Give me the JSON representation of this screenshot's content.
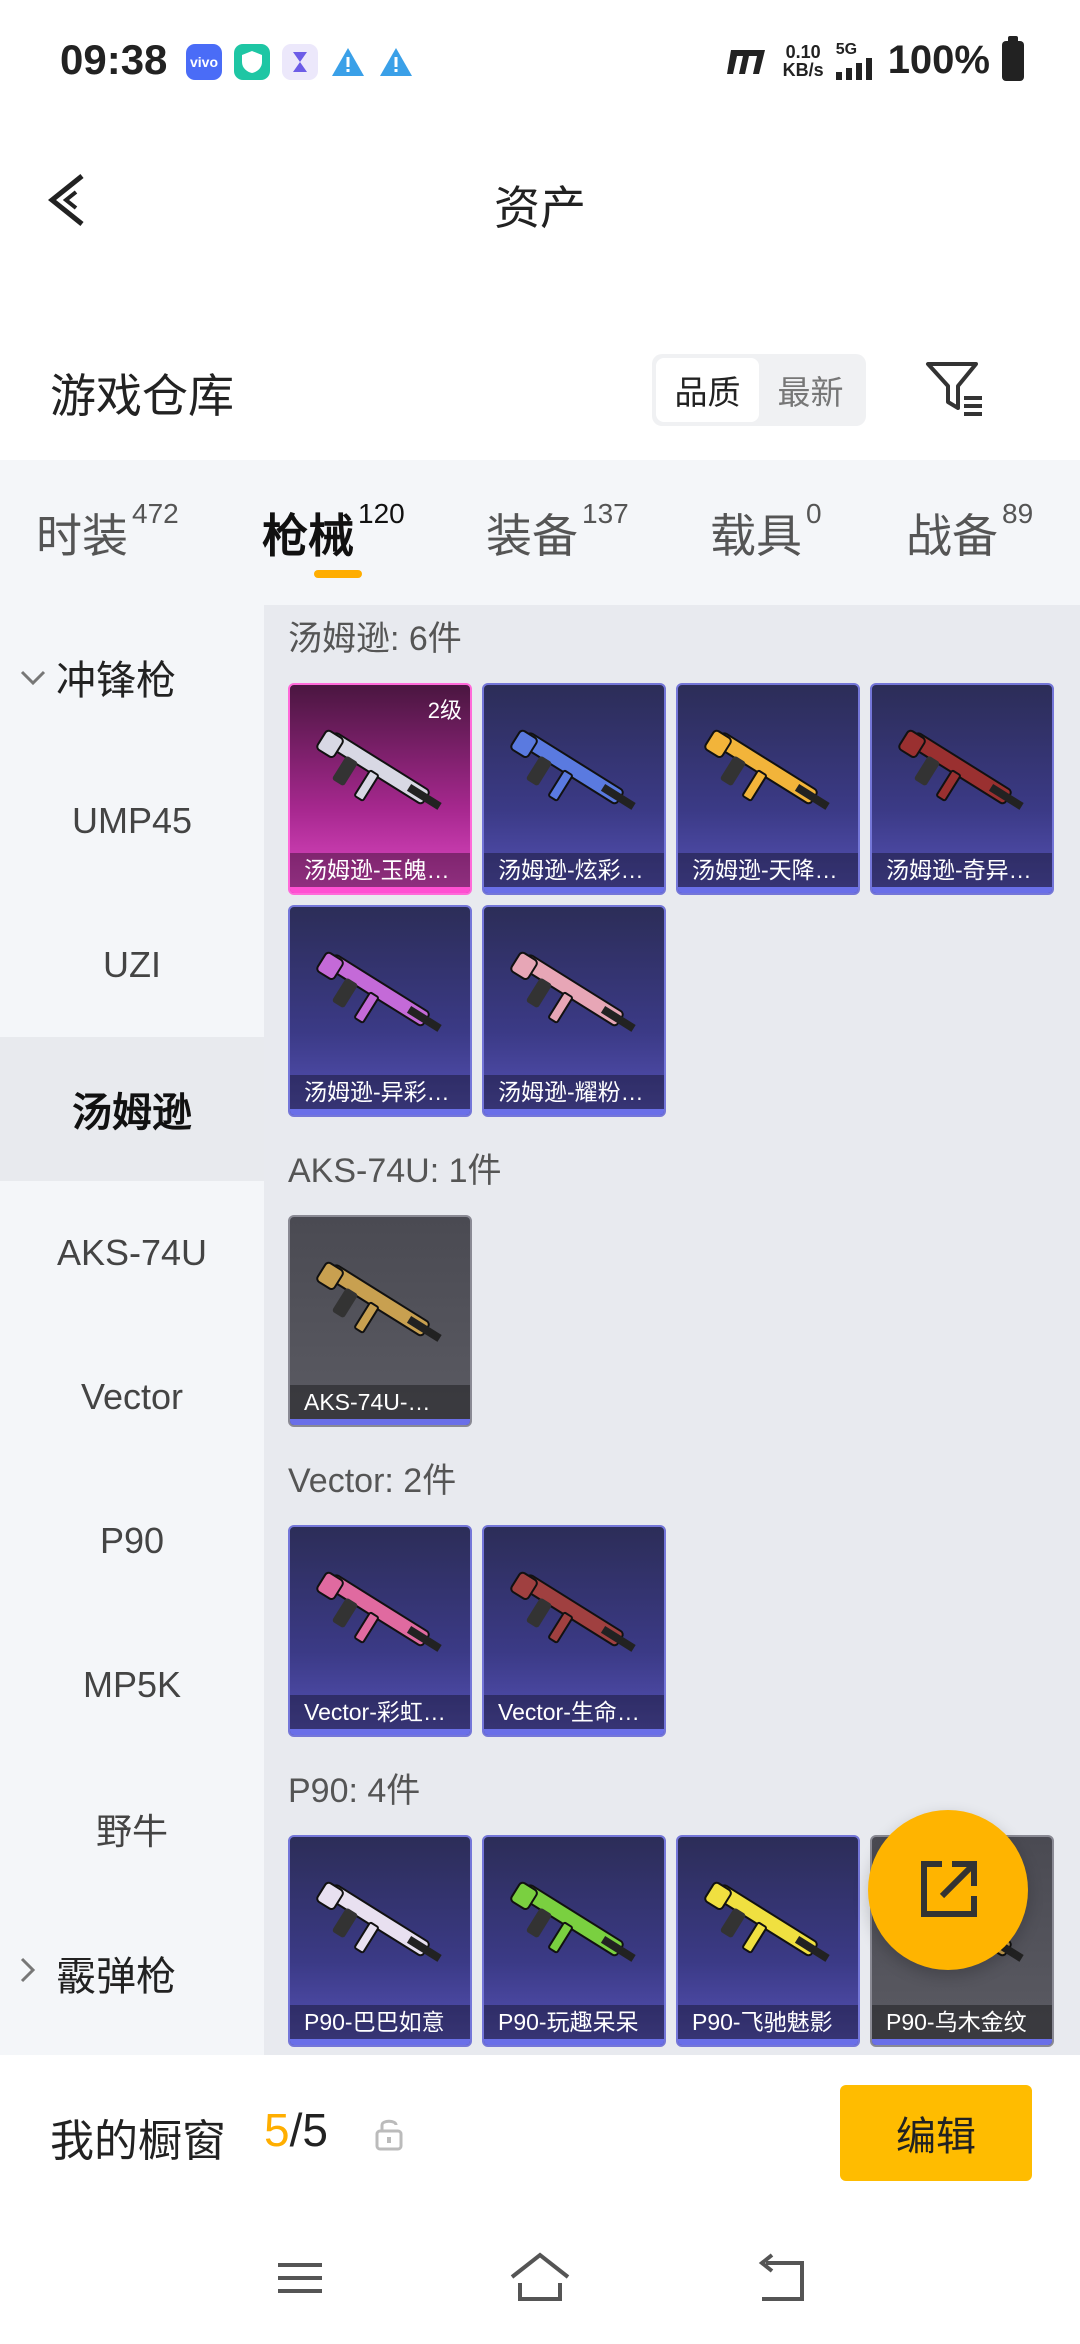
{
  "status_bar": {
    "time": "09:38",
    "net_rate_value": "0.10",
    "net_rate_unit": "KB/s",
    "network": "5G",
    "battery": "100%"
  },
  "header": {
    "title": "资产"
  },
  "warehouse": {
    "title": "游戏仓库",
    "sort_options": [
      "品质",
      "最新"
    ],
    "active_sort": "品质"
  },
  "categories": [
    {
      "label": "时装",
      "count": "472"
    },
    {
      "label": "枪械",
      "count": "120",
      "active": true
    },
    {
      "label": "装备",
      "count": "137"
    },
    {
      "label": "载具",
      "count": "0"
    },
    {
      "label": "战备",
      "count": "89"
    }
  ],
  "sub_categories": [
    {
      "label": "冲锋枪",
      "type": "group",
      "expanded": true
    },
    {
      "label": "UMP45"
    },
    {
      "label": "UZI"
    },
    {
      "label": "汤姆逊",
      "active": true
    },
    {
      "label": "AKS-74U"
    },
    {
      "label": "Vector"
    },
    {
      "label": "P90"
    },
    {
      "label": "MP5K"
    },
    {
      "label": "野牛"
    },
    {
      "label": "霰弹枪",
      "type": "group",
      "expanded": false
    }
  ],
  "groups": [
    {
      "title": "汤姆逊: 6件",
      "items": [
        {
          "name": "汤姆逊-玉魄…",
          "level": "2级",
          "rarity": "pink",
          "color": "#d8d8e4"
        },
        {
          "name": "汤姆逊-炫彩…",
          "rarity": "purple",
          "color": "#5a7ae0"
        },
        {
          "name": "汤姆逊-天降…",
          "rarity": "purple",
          "color": "#f2b43a"
        },
        {
          "name": "汤姆逊-奇异…",
          "rarity": "purple",
          "color": "#9a3030"
        },
        {
          "name": "汤姆逊-异彩…",
          "rarity": "purple",
          "color": "#c46ad8"
        },
        {
          "name": "汤姆逊-耀粉…",
          "rarity": "purple",
          "color": "#e7a6b6"
        }
      ]
    },
    {
      "title": "AKS-74U: 1件",
      "items": [
        {
          "name": "AKS-74U-…",
          "rarity": "grey",
          "color": "#c8a050"
        }
      ]
    },
    {
      "title": "Vector: 2件",
      "items": [
        {
          "name": "Vector-彩虹…",
          "rarity": "purple",
          "color": "#e06aa0"
        },
        {
          "name": "Vector-生命…",
          "rarity": "purple",
          "color": "#a04040"
        }
      ]
    },
    {
      "title": "P90: 4件",
      "items": [
        {
          "name": "P90-巴巴如意",
          "rarity": "purple",
          "color": "#e8e0f0"
        },
        {
          "name": "P90-玩趣呆呆",
          "rarity": "purple",
          "color": "#7ad040"
        },
        {
          "name": "P90-飞驰魅影",
          "rarity": "purple",
          "color": "#f0e040"
        },
        {
          "name": "P90-乌木金纹",
          "rarity": "grey",
          "color": "#c8a050"
        }
      ]
    }
  ],
  "showcase": {
    "label": "我的橱窗",
    "current": "5",
    "total": "/5",
    "edit_label": "编辑"
  },
  "colors": {
    "accent": "#ffb400",
    "tab_underline": "#ffad00"
  }
}
